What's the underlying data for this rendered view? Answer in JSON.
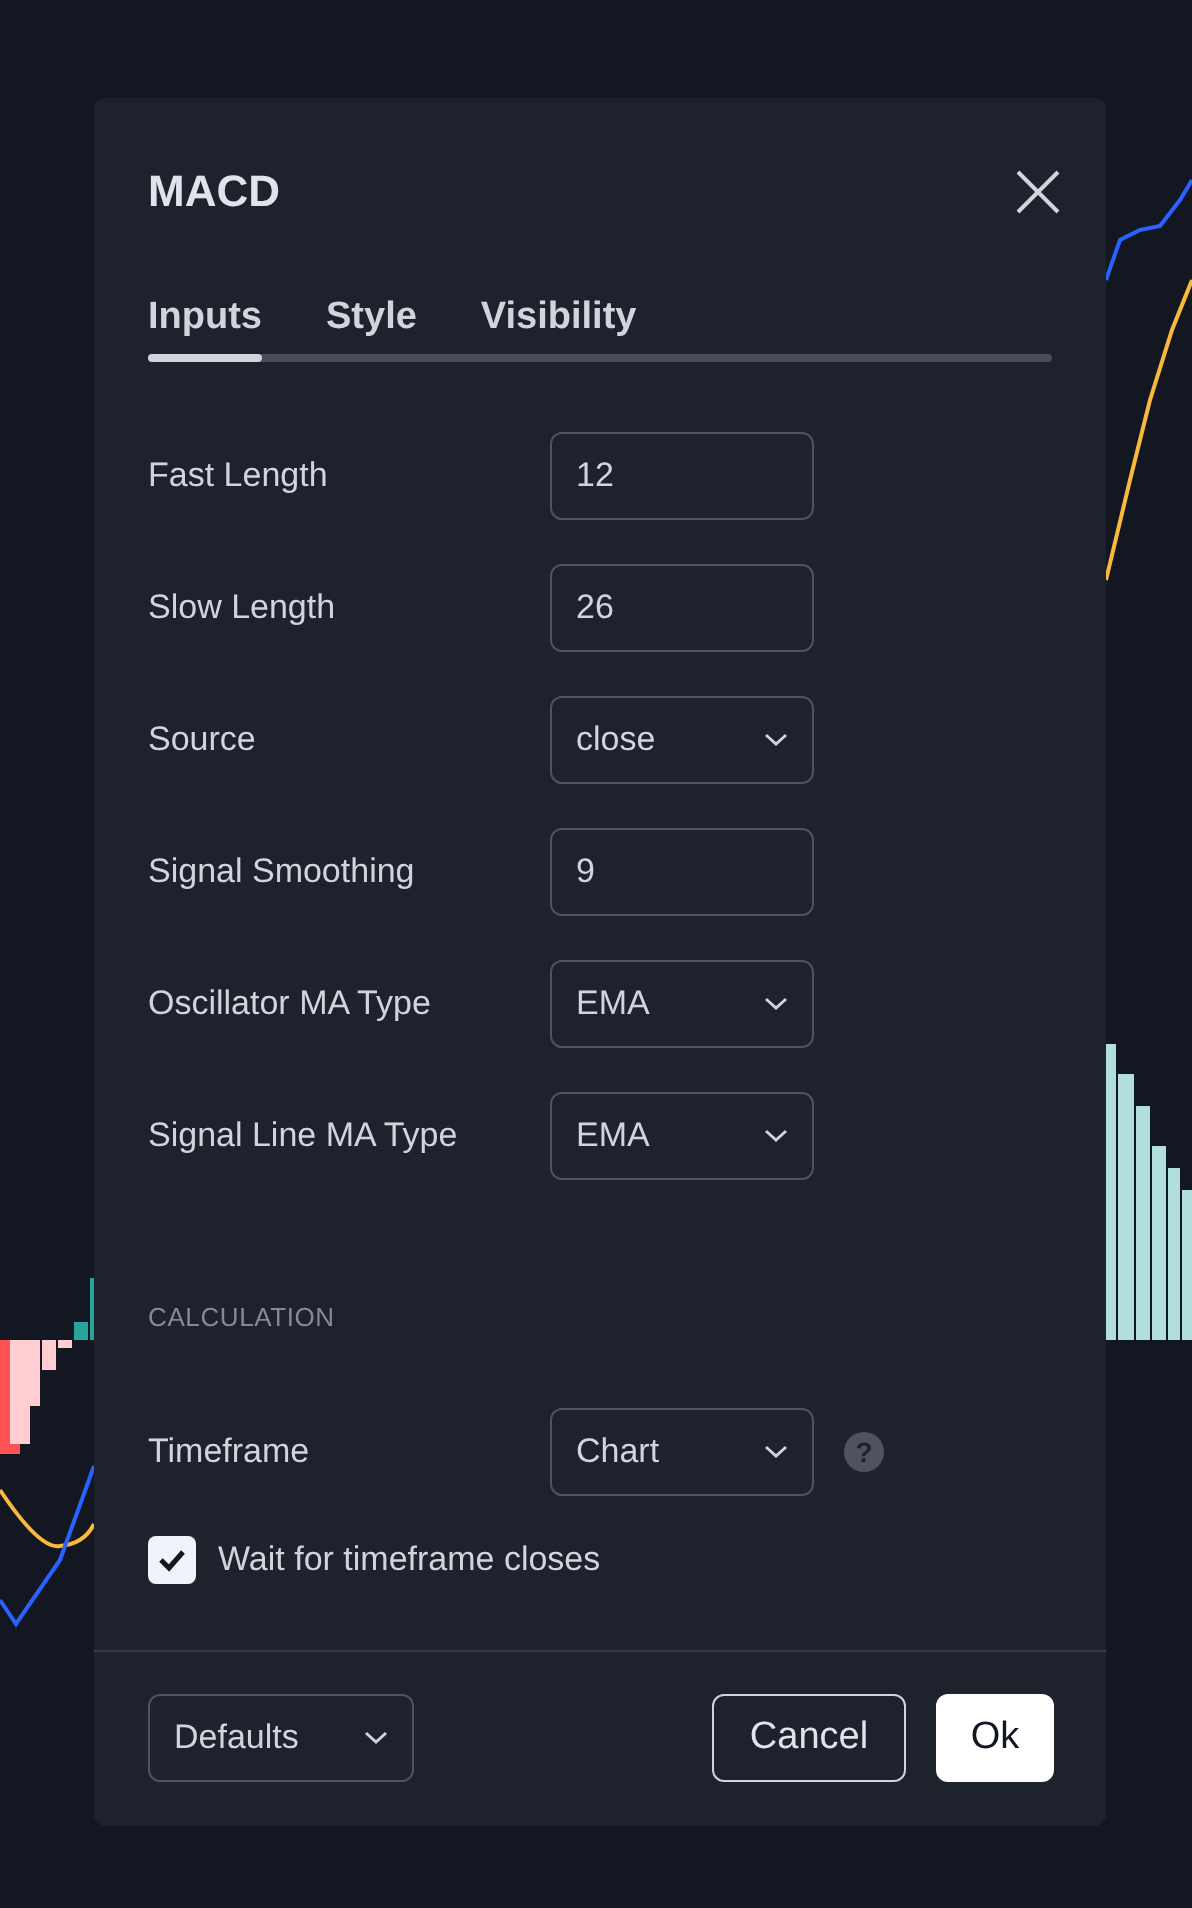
{
  "dialog": {
    "title": "MACD"
  },
  "tabs": [
    {
      "label": "Inputs",
      "selected": true
    },
    {
      "label": "Style",
      "selected": false
    },
    {
      "label": "Visibility",
      "selected": false
    }
  ],
  "inputs": [
    {
      "label": "Fast Length",
      "kind": "number",
      "value": "12"
    },
    {
      "label": "Slow Length",
      "kind": "number",
      "value": "26"
    },
    {
      "label": "Source",
      "kind": "select",
      "value": "close"
    },
    {
      "label": "Signal Smoothing",
      "kind": "number",
      "value": "9"
    },
    {
      "label": "Oscillator MA Type",
      "kind": "select",
      "value": "EMA"
    },
    {
      "label": "Signal Line MA Type",
      "kind": "select",
      "value": "EMA"
    }
  ],
  "section": {
    "heading": "CALCULATION"
  },
  "timeframe": {
    "label": "Timeframe",
    "kind": "select",
    "value": "Chart",
    "help": "?"
  },
  "wait_checkbox": {
    "label": "Wait for timeframe closes",
    "checked": true
  },
  "footer": {
    "defaults": "Defaults",
    "cancel": "Cancel",
    "ok": "Ok"
  }
}
